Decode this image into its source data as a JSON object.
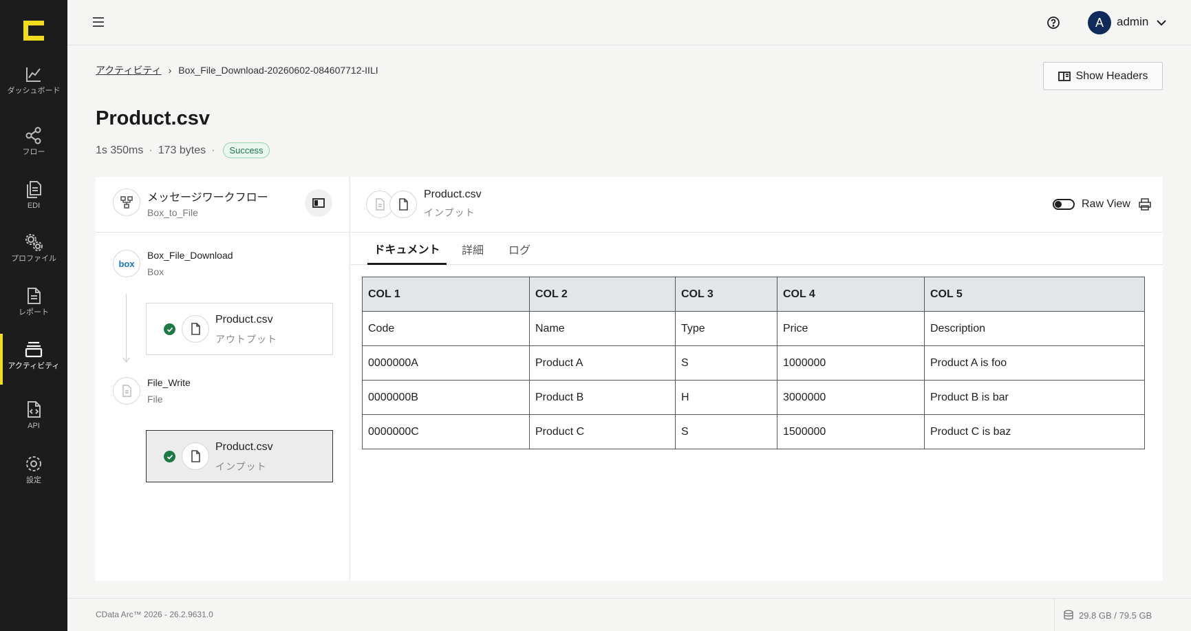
{
  "sidebar": {
    "items": [
      {
        "label": "ダッシュボード",
        "icon": "chart-line-icon"
      },
      {
        "label": "フロー",
        "icon": "share-nodes-icon"
      },
      {
        "label": "EDI",
        "icon": "documents-icon"
      },
      {
        "label": "プロファイル",
        "icon": "gears-icon"
      },
      {
        "label": "レポート",
        "icon": "report-icon"
      },
      {
        "label": "アクティビティ",
        "icon": "layers-icon",
        "active": true
      },
      {
        "label": "API",
        "icon": "code-file-icon"
      },
      {
        "label": "設定",
        "icon": "gear-icon"
      }
    ]
  },
  "topbar": {
    "avatar_initial": "A",
    "user_name": "admin"
  },
  "breadcrumb": {
    "parent": "アクティビティ",
    "current": "Box_File_Download-20260602-084607712-IILI"
  },
  "header": {
    "title": "Product.csv",
    "duration": "1s 350ms",
    "size": "173 bytes",
    "status": "Success",
    "show_headers_label": "Show Headers"
  },
  "workflow": {
    "title": "メッセージワークフロー",
    "subtitle": "Box_to_File",
    "nodes": [
      {
        "name": "Box_File_Download",
        "type": "Box",
        "icon_text": "box"
      },
      {
        "name": "File_Write",
        "type": "File"
      }
    ],
    "messages": [
      {
        "name": "Product.csv",
        "direction": "アウトプット"
      },
      {
        "name": "Product.csv",
        "direction": "インプット"
      }
    ]
  },
  "document": {
    "name": "Product.csv",
    "direction": "インプット",
    "raw_view_label": "Raw View",
    "tabs": [
      "ドキュメント",
      "詳細",
      "ログ"
    ],
    "table": {
      "headers": [
        "COL 1",
        "COL 2",
        "COL 3",
        "COL 4",
        "COL 5"
      ],
      "rows": [
        [
          "Code",
          "Name",
          "Type",
          "Price",
          "Description"
        ],
        [
          "0000000A",
          "Product A",
          "S",
          "1000000",
          "Product A is foo"
        ],
        [
          "0000000B",
          "Product B",
          "H",
          "3000000",
          "Product B is bar"
        ],
        [
          "0000000C",
          "Product C",
          "S",
          "1500000",
          "Product C is baz"
        ]
      ]
    }
  },
  "footer": {
    "version": "CData Arc™ 2026 - 26.2.9631.0",
    "storage": "29.8 GB / 79.5 GB"
  },
  "colors": {
    "sidebar_bg": "#1c1c1c",
    "accent": "#f1dc1d",
    "success": "#1d7a45",
    "avatar": "#0e2b5c"
  }
}
